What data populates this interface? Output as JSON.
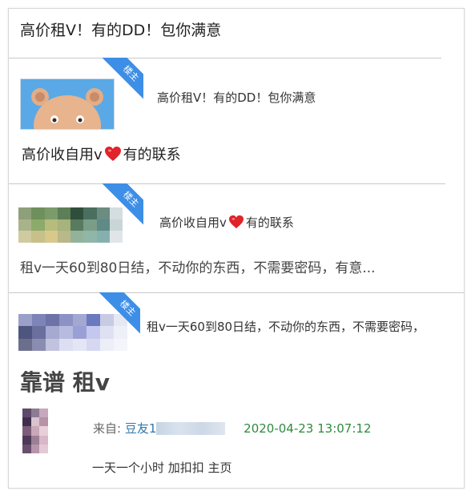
{
  "posts": [
    {
      "title": "高价租V！有的DD！包你满意"
    },
    {
      "badge": "楼主",
      "reply_text": "高价租V！有的DD！包你满意",
      "title_before": "高价收自用v",
      "title_after": "有的联系"
    },
    {
      "badge": "楼主",
      "reply_before": "高价收自用v",
      "reply_after": "有的联系",
      "title": "租v一天60到80日结，不动你的东西，不需要密码，有意..."
    },
    {
      "badge": "楼主",
      "reply_text": "租v一天60到80日结，不动你的东西，不需要密码，",
      "title": "靠谱 租v"
    }
  ],
  "meta": {
    "from_label": "来自:",
    "user": "豆友1",
    "date": "2020-04-23 13:07:12"
  },
  "body_text": "一天一个小时 加扣扣 主页",
  "icons": [
    "heart-icon",
    "bear-avatar-icon"
  ],
  "colors": {
    "badge": "#3d8ee6",
    "date": "#2e8b3e",
    "user": "#3377aa",
    "heart": "#e0242a"
  }
}
